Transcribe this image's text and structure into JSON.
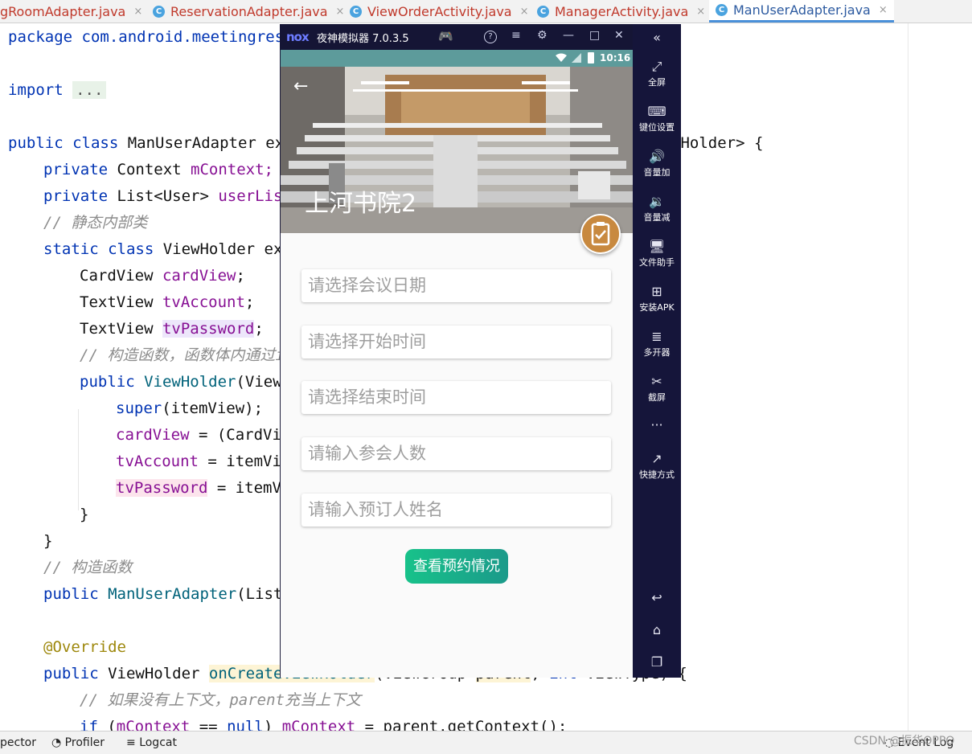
{
  "ide": {
    "tabs": [
      {
        "label": "gRoomAdapter.java",
        "icon": "java-class-icon",
        "active": false
      },
      {
        "label": "ReservationAdapter.java",
        "icon": "java-class-icon",
        "active": false
      },
      {
        "label": "ViewOrderActivity.java",
        "icon": "java-class-icon",
        "active": false
      },
      {
        "label": "ManagerActivity.java",
        "icon": "java-class-icon",
        "active": false
      },
      {
        "label": "ManUserAdapter.java",
        "icon": "java-class-icon",
        "active": true
      }
    ],
    "close_glyph": "×",
    "code": {
      "l1": "package com.android.meetingres",
      "l2a": "import ",
      "l2b": "...",
      "l3a": "public class ",
      "l3b": "ManUserAdapter ex",
      "l3c": "wHolder> {",
      "l4a": "private ",
      "l4b": "Context ",
      "l4c": "mContext;",
      "l5a": "private ",
      "l5b": "List<User> ",
      "l5c": "userLis",
      "l6": "// 静态内部类",
      "l7a": "static class ",
      "l7b": "ViewHolder ex",
      "l8a": "CardView ",
      "l8b": "cardView",
      "l8c": ";",
      "l9a": "TextView ",
      "l9b": "tvAccount",
      "l9c": ";",
      "l10a": "TextView ",
      "l10b": "tvPassword",
      "l10c": ";",
      "l11": "// 构造函数，函数体内通过it",
      "l12a": "public ",
      "l12b": "ViewHolder",
      "l12c": "(View",
      "l13a": "super",
      "l13b": "(itemView);",
      "l14a": "cardView",
      "l14b": " = (CardVi",
      "l15a": "tvAccount",
      "l15b": " = itemVi",
      "l16a": "tvPassword",
      "l16b": " = itemV",
      "l17": "}",
      "l18": "}",
      "l19": "// 构造函数",
      "l20a": "public ",
      "l20b": "ManUserAdapter",
      "l20c": "(List",
      "l21": "@Override",
      "l22a": "public ",
      "l22b": "ViewHolder ",
      "l22c": "onCreateViewHolder",
      "l22d": "(ViewGroup ",
      "l22e": "parent",
      "l22f": ", ",
      "l22g": "int ",
      "l22h": "viewType) {",
      "l23": "// 如果没有上下文，parent充当上下文",
      "l24a": "if ",
      "l24b": "(",
      "l24c": "mContext",
      "l24d": " == ",
      "l24e": "null",
      "l24f": ") ",
      "l24g": "mContext",
      "l24h": " = parent.getContext();"
    },
    "status": {
      "inspector": "pector",
      "profiler": "Profiler",
      "logcat": "Logcat",
      "event_log": "Event Log"
    },
    "watermark": "CSDN @振华OPPO"
  },
  "emulator": {
    "brand": "nox",
    "title": "夜神模拟器 7.0.3.5",
    "controls": {
      "gamepad": "🎮",
      "help": "?",
      "menu": "≡",
      "settings": "⚙",
      "minimize": "—",
      "maximize": "□",
      "close": "✕",
      "collapse": "«"
    },
    "sidebar": [
      {
        "icon": "fullscreen-icon",
        "glyph": "⤢",
        "label": "全屏"
      },
      {
        "icon": "keyboard-icon",
        "glyph": "⌨",
        "label": "键位设置"
      },
      {
        "icon": "volume-up-icon",
        "glyph": "🔊",
        "label": "音量加"
      },
      {
        "icon": "volume-down-icon",
        "glyph": "🔉",
        "label": "音量减"
      },
      {
        "icon": "file-helper-icon",
        "glyph": "🖥",
        "label": "文件助手"
      },
      {
        "icon": "install-apk-icon",
        "glyph": "⊞",
        "label": "安装APK"
      },
      {
        "icon": "multi-instance-icon",
        "glyph": "≣",
        "label": "多开器"
      },
      {
        "icon": "screenshot-icon",
        "glyph": "✂",
        "label": "截屏"
      },
      {
        "icon": "more-icon",
        "glyph": "···",
        "label": ""
      },
      {
        "icon": "shortcut-icon",
        "glyph": "↗",
        "label": "快捷方式"
      }
    ],
    "nav": {
      "back": "↩",
      "home": "⌂",
      "recent": "❐"
    },
    "phone": {
      "time": "10:16",
      "hero_title": "上河书院2",
      "back_glyph": "←",
      "fields": [
        {
          "placeholder": "请选择会议日期"
        },
        {
          "placeholder": "请选择开始时间"
        },
        {
          "placeholder": "请选择结束时间"
        },
        {
          "placeholder": "请输入参会人数"
        },
        {
          "placeholder": "请输入预订人姓名"
        }
      ],
      "button_label": "查看预约情况"
    }
  },
  "colors": {
    "status_teal": "#5d9b9b",
    "fab": "#c8893f",
    "button_start": "#18c28a",
    "button_end": "#1b9a8a",
    "emu_frame": "#15153a"
  }
}
